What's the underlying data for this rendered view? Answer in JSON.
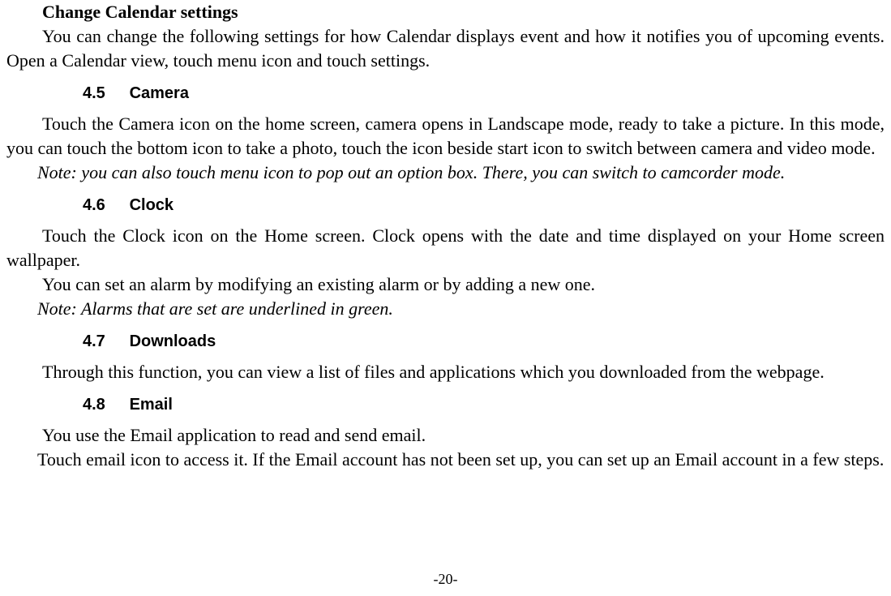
{
  "calendar": {
    "title": "Change Calendar settings",
    "body": "You can change the following settings for how Calendar displays event and how it notifies you of upcoming events. Open a Calendar view, touch menu icon and touch settings."
  },
  "s45": {
    "num": "4.5",
    "title": "Camera",
    "body": "Touch the Camera icon on the home screen, camera opens in Landscape mode, ready to take a picture. In this mode, you can touch the bottom icon to take a photo, touch the icon beside start icon to switch between camera and video mode.",
    "note": "Note: you can also touch menu icon to pop out an option box. There, you can switch to camcorder mode."
  },
  "s46": {
    "num": "4.6",
    "title": "Clock",
    "body1": "Touch the Clock icon on the Home screen. Clock opens with the date and time displayed on your Home screen wallpaper.",
    "body2": "You can set an alarm by modifying an existing alarm or by adding a new one.",
    "note": "Note: Alarms that are set are underlined in green."
  },
  "s47": {
    "num": "4.7",
    "title": "Downloads",
    "body": "Through this function, you can view a list of files and applications which you downloaded from the webpage."
  },
  "s48": {
    "num": "4.8",
    "title": "Email",
    "body1": "You use the Email application to read and send email.",
    "body2": "Touch email icon to access it. If the Email account has not been set up, you can set up an Email account in a few steps."
  },
  "footer": "-20-"
}
